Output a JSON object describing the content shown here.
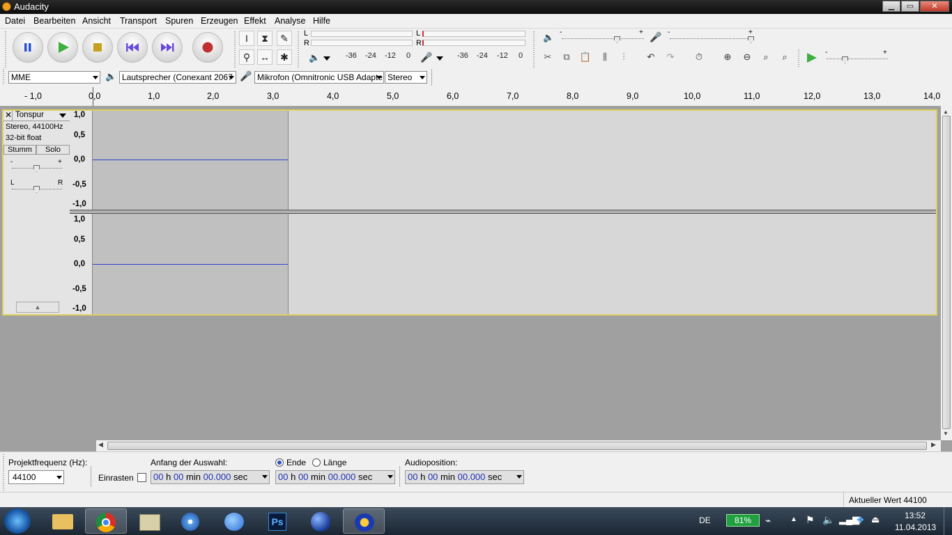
{
  "window": {
    "title": "Audacity",
    "minimize": "▁",
    "maximize": "▭",
    "close": "✕"
  },
  "menu": [
    "Datei",
    "Bearbeiten",
    "Ansicht",
    "Transport",
    "Spuren",
    "Erzeugen",
    "Effekt",
    "Analyse",
    "Hilfe"
  ],
  "meters": {
    "play_l": "L",
    "play_r": "R",
    "rec_l": "L",
    "rec_r": "R",
    "play_scale": [
      "-36",
      "-24",
      "-12",
      "0"
    ],
    "rec_scale": [
      "-36",
      "-24",
      "-12",
      "0"
    ],
    "slider_minus": "-",
    "slider_plus": "+"
  },
  "devices": {
    "host": "MME",
    "output": "Lautsprecher (Conexant 2067",
    "input": "Mikrofon (Omnitronic USB Adapte",
    "channels": "Stereo"
  },
  "ruler": [
    "- 1,0",
    "0,0",
    "1,0",
    "2,0",
    "3,0",
    "4,0",
    "5,0",
    "6,0",
    "7,0",
    "8,0",
    "9,0",
    "10,0",
    "11,0",
    "12,0",
    "13,0",
    "14,0"
  ],
  "track": {
    "name": "Tonspur",
    "close": "✕",
    "info_line1": "Stereo, 44100Hz",
    "info_line2": "32-bit float",
    "mute": "Stumm",
    "solo": "Solo",
    "gain_minus": "-",
    "gain_plus": "+",
    "pan_l": "L",
    "pan_r": "R",
    "collapse": "▲",
    "axis_top": [
      "1,0",
      "0,5",
      "0,0",
      "-0,5",
      "-1,0"
    ],
    "axis_bottom": [
      "1,0",
      "0,5",
      "0,0",
      "-0,5",
      "-1,0"
    ]
  },
  "selection": {
    "project_rate_label": "Projektfrequenz (Hz):",
    "project_rate": "44100",
    "snap_label": "Einrasten",
    "start_label": "Anfang der Auswahl:",
    "end_label": "Ende",
    "length_label": "Länge",
    "audio_pos_label": "Audioposition:",
    "time_h": "00",
    "time_m": "00",
    "time_s": "00.000",
    "unit_h": "h",
    "unit_m": "min",
    "unit_s": "sec"
  },
  "status": {
    "right": "Aktueller Wert 44100"
  },
  "taskbar": {
    "lang": "DE",
    "battery": "81%",
    "time": "13:52",
    "date": "11.04.2013"
  },
  "colors": {
    "accent_wave": "#3040d0",
    "track_border": "#e0d060",
    "selection": "#c0c0c0"
  }
}
